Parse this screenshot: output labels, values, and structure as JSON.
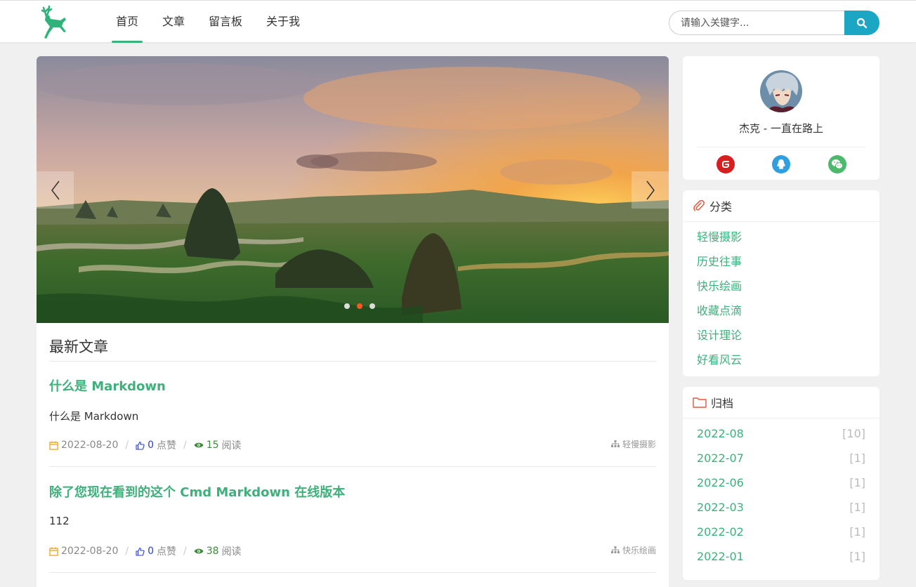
{
  "colors": {
    "accent": "#3eb07b",
    "search_button": "#1ba7c4",
    "active_dot": "#ff5722"
  },
  "nav": {
    "items": [
      {
        "label": "首页",
        "active": true
      },
      {
        "label": "文章"
      },
      {
        "label": "留言板"
      },
      {
        "label": "关于我"
      }
    ]
  },
  "search": {
    "placeholder": "请输入关键字..."
  },
  "carousel": {
    "slide_count": 3,
    "active_index": 1
  },
  "main": {
    "section_title": "最新文章",
    "articles": [
      {
        "title": "什么是 Markdown",
        "summary": "什么是 Markdown",
        "date": "2022-08-20",
        "likes": "0",
        "likes_label": "点赞",
        "reads": "15",
        "reads_label": "阅读",
        "category": "轻慢摄影"
      },
      {
        "title": "除了您现在看到的这个 Cmd Markdown 在线版本",
        "summary": "112",
        "date": "2022-08-20",
        "likes": "0",
        "likes_label": "点赞",
        "reads": "38",
        "reads_label": "阅读",
        "category": "快乐绘画"
      }
    ]
  },
  "profile": {
    "name": "杰克 - 一直在路上",
    "social_icons": [
      "gitee-icon",
      "qq-icon",
      "wechat-icon"
    ]
  },
  "categories": {
    "title": "分类",
    "items": [
      "轻慢摄影",
      "历史往事",
      "快乐绘画",
      "收藏点滴",
      "设计理论",
      "好看风云"
    ]
  },
  "archive": {
    "title": "归档",
    "items": [
      {
        "month": "2022-08",
        "count": "[10]"
      },
      {
        "month": "2022-07",
        "count": "[1]"
      },
      {
        "month": "2022-06",
        "count": "[1]"
      },
      {
        "month": "2022-03",
        "count": "[1]"
      },
      {
        "month": "2022-02",
        "count": "[1]"
      },
      {
        "month": "2022-01",
        "count": "[1]"
      }
    ]
  }
}
